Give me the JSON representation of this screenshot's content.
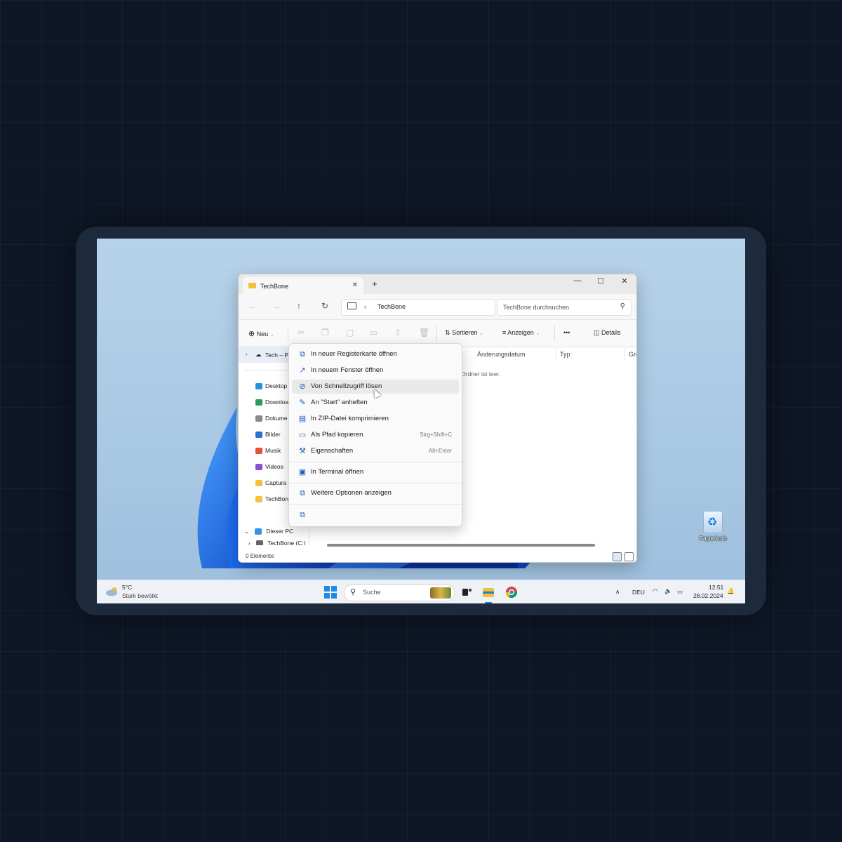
{
  "window": {
    "tab_title": "TechBone",
    "tab_close": "✕",
    "new_tab": "+",
    "controls": {
      "minimize": "—",
      "maximize": "☐",
      "close": "✕"
    },
    "nav": {
      "back": "←",
      "forward": "→",
      "up": "↑",
      "refresh": "↻"
    },
    "breadcrumb": "TechBone",
    "search_placeholder": "TechBone durchsuchen"
  },
  "commandbar": {
    "new_label": "Neu",
    "sort_label": "Sortieren",
    "view_label": "Anzeigen",
    "more_label": "•••",
    "details_label": "Details"
  },
  "navpane": {
    "top_item": "Tech – Pe",
    "items": [
      {
        "label": "Desktop",
        "color": "#2b8fe0"
      },
      {
        "label": "Downloa",
        "color": "#2e9b5c"
      },
      {
        "label": "Dokume",
        "color": "#8a8a8a"
      },
      {
        "label": "Bilder",
        "color": "#2b6fd6"
      },
      {
        "label": "Musik",
        "color": "#e0533a"
      },
      {
        "label": "Videos",
        "color": "#8b4fd6"
      },
      {
        "label": "Captura",
        "color": "#f3c13a"
      },
      {
        "label": "TechBone",
        "color": "#f3c13a"
      }
    ],
    "this_pc": "Dieser PC",
    "drive": "TechBone (C:)"
  },
  "content": {
    "columns": [
      "Änderungsdatum",
      "Typ",
      "Grö"
    ],
    "empty_text": "r Ordner ist leer."
  },
  "status": {
    "items_count": "0 Elemente"
  },
  "context_menu": {
    "items": [
      {
        "label": "In neuer Registerkarte öffnen",
        "shortcut": "",
        "icon": "new-tab-icon",
        "glyph": "⧉"
      },
      {
        "label": "In neuem Fenster öffnen",
        "shortcut": "",
        "icon": "new-window-icon",
        "glyph": "↗"
      },
      {
        "label": "Von Schnellzugriff lösen",
        "shortcut": "",
        "icon": "unpin-icon",
        "glyph": "⊘"
      },
      {
        "label": "An \"Start\" anheften",
        "shortcut": "",
        "icon": "pin-icon",
        "glyph": "✎"
      },
      {
        "label": "In ZIP-Datei komprimieren",
        "shortcut": "",
        "icon": "zip-icon",
        "glyph": "▤"
      },
      {
        "label": "Als Pfad kopieren",
        "shortcut": "Strg+Shift+C",
        "icon": "copy-path-icon",
        "glyph": "▭"
      },
      {
        "label": "Eigenschaften",
        "shortcut": "Alt+Enter",
        "icon": "wrench-icon",
        "glyph": "⚒"
      },
      {
        "label": "In Terminal öffnen",
        "shortcut": "",
        "icon": "terminal-icon",
        "glyph": "▣"
      },
      {
        "label": "Weitere Optionen anzeigen",
        "shortcut": "",
        "icon": "more-options-icon",
        "glyph": "⧉"
      }
    ],
    "footer_glyph": "⧉"
  },
  "desktop": {
    "recycle_bin_label": "Papierkorb"
  },
  "taskbar": {
    "temperature": "5°C",
    "weather_desc": "Stark bewölkt",
    "search_label": "Suche",
    "language": "DEU",
    "time": "12:51",
    "date": "28.02.2024",
    "up_arrow": "∧",
    "bell": "🔔"
  }
}
